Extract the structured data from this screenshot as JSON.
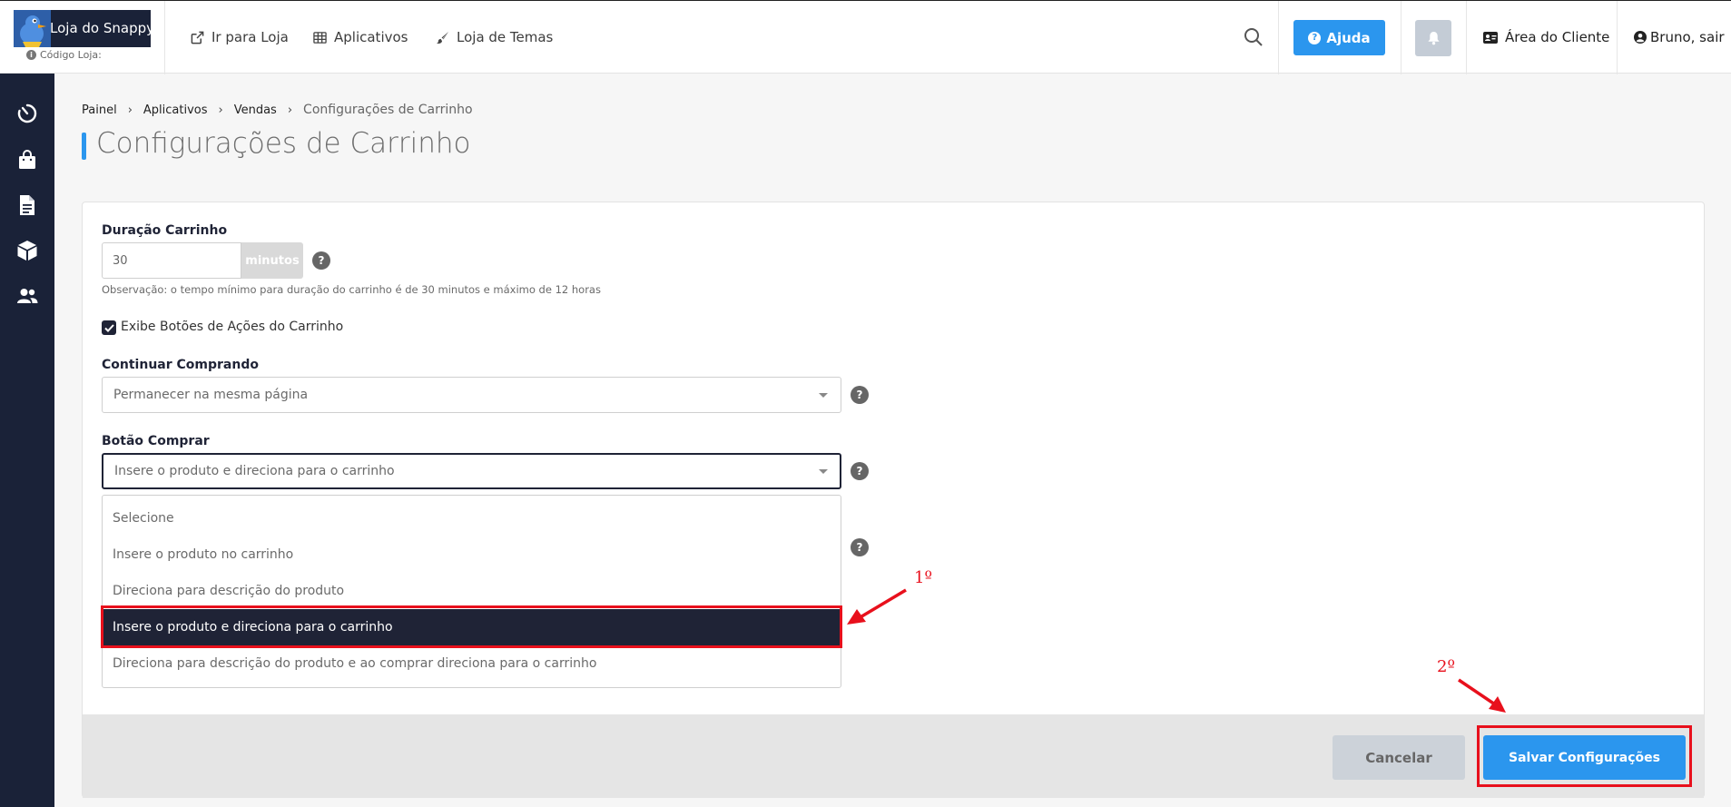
{
  "header": {
    "logo_text": "Loja do Snappy",
    "store_code_label": "Código Loja:",
    "nav": [
      {
        "label": "Ir para Loja",
        "icon": "external-link-icon"
      },
      {
        "label": "Aplicativos",
        "icon": "grid-icon"
      },
      {
        "label": "Loja de Temas",
        "icon": "brush-icon"
      }
    ],
    "help_label": "Ajuda",
    "client_area_label": "Área do Cliente",
    "user_label": "Bruno, sair"
  },
  "sidebar": {
    "icons": [
      "dashboard-gauge-icon",
      "shopping-bag-icon",
      "document-icon",
      "box-icon",
      "users-icon"
    ]
  },
  "breadcrumb": {
    "items": [
      "Painel",
      "Aplicativos",
      "Vendas"
    ],
    "current": "Configurações de Carrinho"
  },
  "page_title": "Configurações de Carrinho",
  "form": {
    "duration": {
      "label": "Duração Carrinho",
      "value": "30",
      "addon": "minutos",
      "note": "Observação: o tempo mínimo para duração do carrinho é de 30 minutos e máximo de 12 horas"
    },
    "show_actions": {
      "label": "Exibe Botões de Ações do Carrinho",
      "checked": true
    },
    "continue_shopping": {
      "label": "Continuar Comprando",
      "value": "Permanecer na mesma página"
    },
    "buy_button": {
      "label": "Botão Comprar",
      "value": "Insere o produto e direciona para o carrinho",
      "options": [
        "Selecione",
        "Insere o produto no carrinho",
        "Direciona para descrição do produto",
        "Insere o produto e direciona para o carrinho",
        "Direciona para descrição do produto e ao comprar direciona para o carrinho"
      ],
      "selected_index": 3
    },
    "help_glyph": "?"
  },
  "footer": {
    "cancel_label": "Cancelar",
    "save_label": "Salvar Configurações"
  },
  "annotations": {
    "first": "1º",
    "second": "2º",
    "color": "#e8101c"
  },
  "colors": {
    "accent": "#2b96ee",
    "sidebar_bg": "#1a2238",
    "selected_bg": "#1f2336"
  }
}
